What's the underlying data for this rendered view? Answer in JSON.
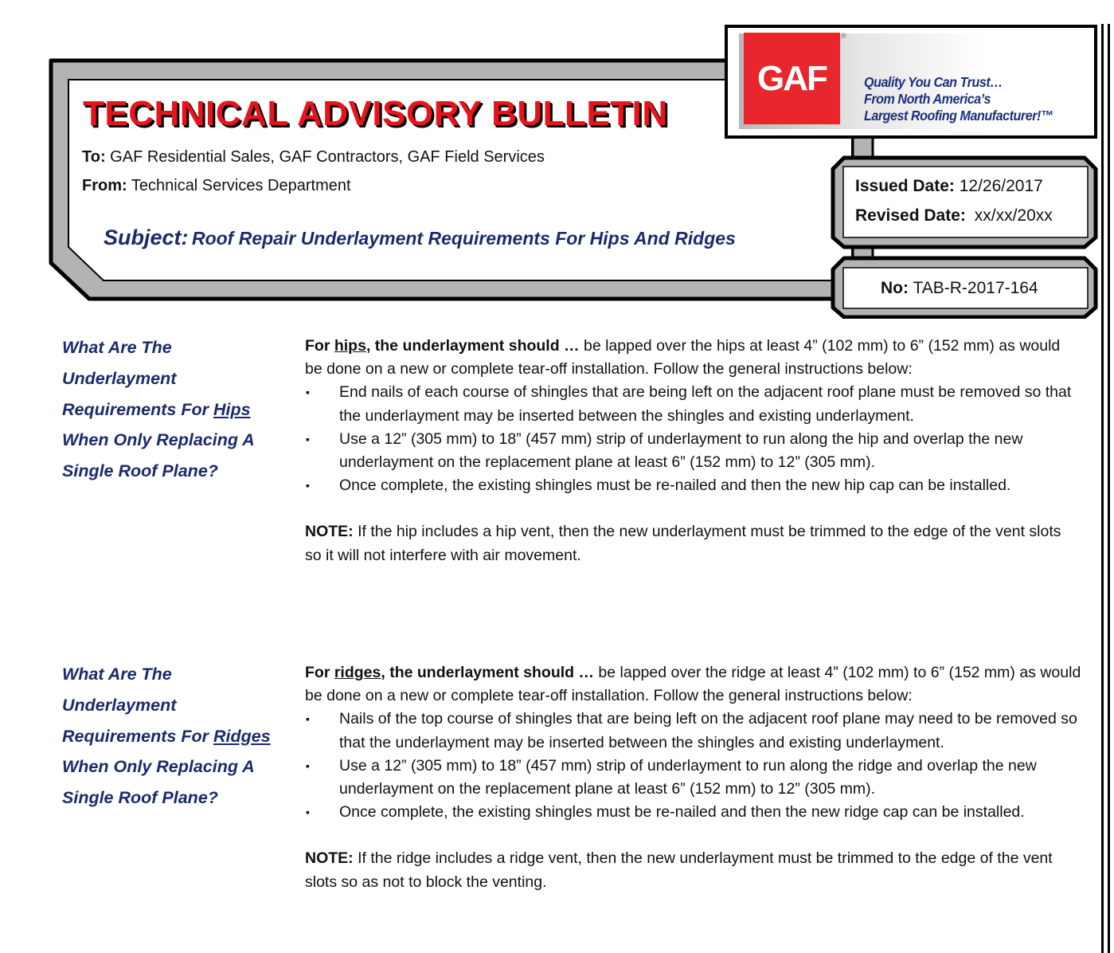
{
  "header": {
    "title": "TECHNICAL ADVISORY BULLETIN",
    "to_label": "To:",
    "to_value": "GAF Residential Sales, GAF Contractors, GAF Field Services",
    "from_label": "From:",
    "from_value": "Technical Services Department",
    "subject_label": "Subject:",
    "subject_value": "Roof Repair Underlayment Requirements For Hips And Ridges"
  },
  "logo": {
    "brand": "GAF",
    "registered": "®",
    "tagline_1": "Quality You Can Trust…",
    "tagline_2": "From North America’s",
    "tagline_3": "Largest Roofing Manufacturer!™",
    "brand_color": "#e8262c",
    "tagline_color": "#1b2f7a"
  },
  "dates": {
    "issued_label": "Issued Date:",
    "issued_value": "12/26/2017",
    "revised_label": "Revised Date:",
    "revised_value": "xx/xx/20xx",
    "no_label": "No:",
    "no_value": "TAB-R-2017-164"
  },
  "sections": [
    {
      "q_1": "What Are The",
      "q_2": "Underlayment",
      "q_3": "Requirements For",
      "q_3_u": "Hips",
      "q_4": "When Only Replacing A",
      "q_5": "Single Roof Plane?",
      "intro_b1": "For",
      "intro_u": "hips",
      "intro_b2": ", the underlayment should …",
      "intro_rest": " be lapped over the hips at least 4” (102 mm) to 6” (152 mm) as would be done on a new or complete tear-off installation.  Follow the general instructions below:",
      "bullets": [
        "End nails of each course of shingles that are being left on the adjacent roof plane must be removed so that the underlayment may be inserted between the shingles and existing underlayment.",
        "Use a 12” (305 mm) to 18” (457 mm) strip of underlayment to run along the hip and overlap the new underlayment on the replacement plane at least 6” (152 mm) to 12” (305 mm).",
        "Once complete, the existing shingles must be re-nailed and then the new hip cap can be installed."
      ],
      "note_label": "NOTE:",
      "note_text": " If the hip includes a hip vent, then the new underlayment must be trimmed to the edge of the vent slots so it will not interfere with air movement."
    },
    {
      "q_1": "What Are The",
      "q_2": "Underlayment",
      "q_3": "Requirements For",
      "q_3_u": "Ridges",
      "q_4": "When Only Replacing A",
      "q_5": "Single Roof Plane?",
      "intro_b1": "For",
      "intro_u": "ridges",
      "intro_b2": ", the underlayment should …",
      "intro_rest": " be lapped over the ridge at least 4” (102 mm) to 6” (152 mm) as would be done on a new or complete tear-off installation. Follow the general instructions below:",
      "bullets": [
        "Nails of the top course of shingles that are being left on the adjacent roof plane may need to be removed so that the underlayment may be inserted between the shingles and existing underlayment.",
        "Use a 12” (305 mm) to 18” (457 mm) strip of underlayment to run along the ridge and overlap the new underlayment on the replacement plane at least 6” (152 mm) to 12” (305 mm).",
        "Once complete, the existing shingles must be re-nailed and then the new ridge cap can be installed."
      ],
      "note_label": "NOTE:",
      "note_text": " If the ridge includes a ridge vent, then the new underlayment must be trimmed to the edge of the vent slots so as not to block the venting."
    }
  ],
  "bullet_glyph": "▪",
  "colors": {
    "title_red": "#e8141b",
    "navy": "#1b2a6b",
    "frame_gray": "#b3b3b3"
  }
}
